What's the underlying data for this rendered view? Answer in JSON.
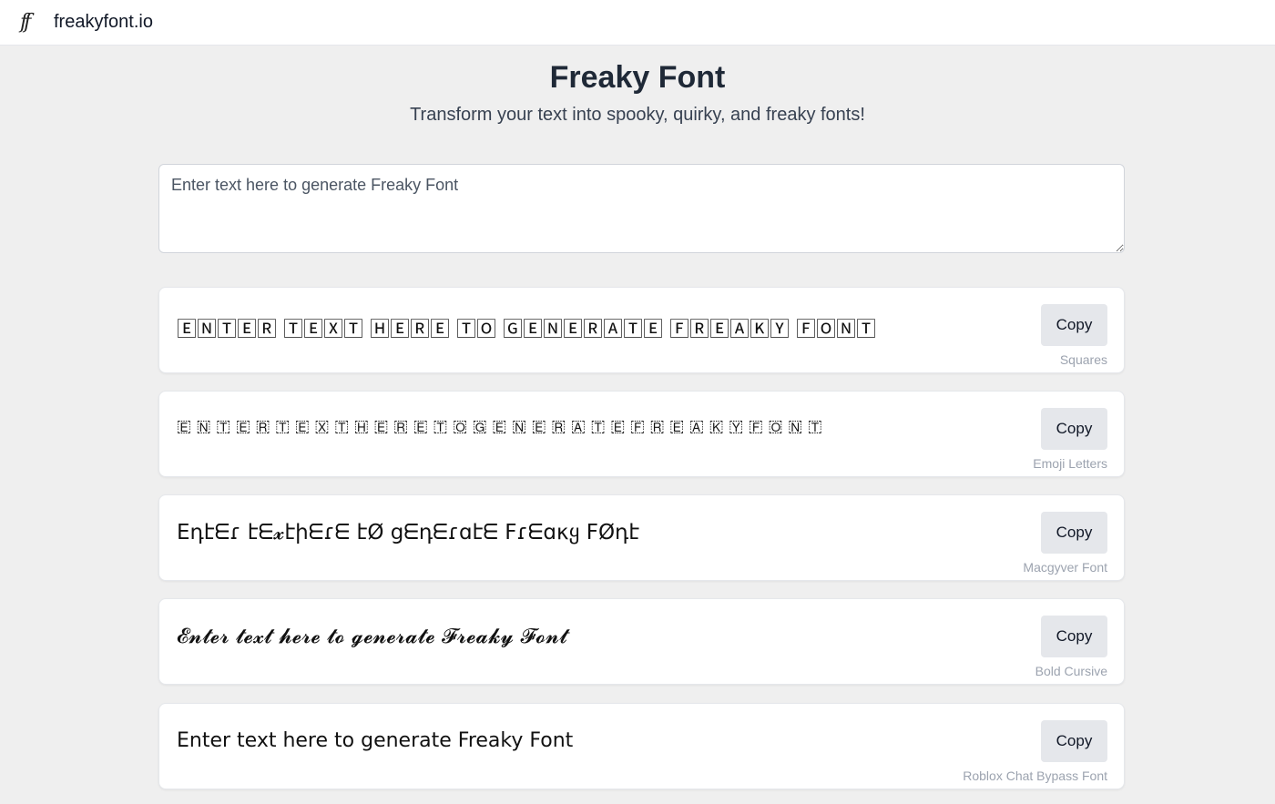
{
  "header": {
    "logo_glyph": "ff",
    "brand": "freakyfont.io"
  },
  "hero": {
    "title": "Freaky Font",
    "subtitle": "Transform your text into spooky, quirky, and freaky fonts!"
  },
  "input": {
    "placeholder": "Enter text here to generate Freaky Font",
    "value": ""
  },
  "results": [
    {
      "text": "🄴🄽🅃🄴🅁 🅃🄴🅇🅃 🄷🄴🅁🄴 🅃🄾 🄶🄴🄽🄴🅁🄰🅃🄴 🄵🅁🄴🄰🄺🅈 🄵🄾🄽🅃",
      "copy_label": "Copy",
      "style_name": "Squares"
    },
    {
      "text": "🇪 🇳 🇹 🇪 🇷  🇹 🇪 🇽 🇹  🇭 🇪 🇷 🇪  🇹 🇴  🇬 🇪 🇳 🇪 🇷 🇦 🇹 🇪  🇫 🇷 🇪 🇦 🇰 🇾  🇫 🇴 🇳 🇹",
      "copy_label": "Copy",
      "style_name": "Emoji Letters"
    },
    {
      "text": "Eդէᗴɾ էᗴ𝔁էիᗴɾᗴ էØ ցᗴդᗴɾɑէᗴ Fɾᗴɑκყ FØդէ",
      "copy_label": "Copy",
      "style_name": "Macgyver Font"
    },
    {
      "text": "𝓔𝓷𝓽𝓮𝓻 𝓽𝓮𝔁𝓽 𝓱𝓮𝓻𝓮 𝓽𝓸 𝓰𝓮𝓷𝓮𝓻𝓪𝓽𝓮 𝓕𝓻𝓮𝓪𝓴𝔂 𝓕𝓸𝓷𝓽",
      "copy_label": "Copy",
      "style_name": "Bold Cursive"
    },
    {
      "text": "Eոter text here to generate Freaky Foոt",
      "copy_label": "Copy",
      "style_name": "Roblox Chat Bypass Font"
    }
  ]
}
